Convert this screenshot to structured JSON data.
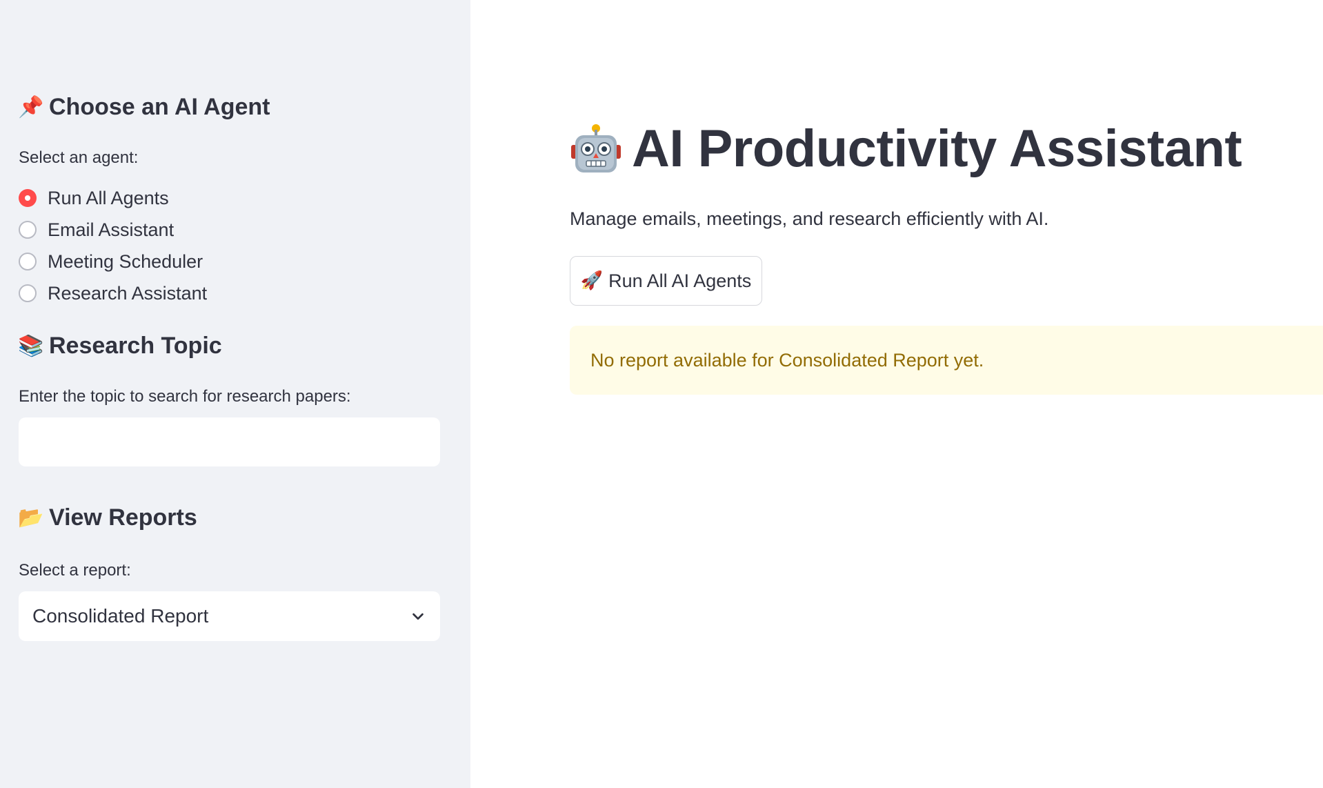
{
  "sidebar": {
    "agent_section": {
      "icon": "pushpin-icon",
      "emoji": "📌",
      "title": "Choose an AI Agent",
      "select_label": "Select an agent:",
      "options": [
        {
          "label": "Run All Agents",
          "selected": true
        },
        {
          "label": "Email Assistant",
          "selected": false
        },
        {
          "label": "Meeting Scheduler",
          "selected": false
        },
        {
          "label": "Research Assistant",
          "selected": false
        }
      ]
    },
    "research_section": {
      "icon": "books-icon",
      "emoji": "📚",
      "title": "Research Topic",
      "input_label": "Enter the topic to search for research papers:",
      "input_value": "",
      "input_placeholder": ""
    },
    "reports_section": {
      "icon": "folder-icon",
      "emoji": "📂",
      "title": "View Reports",
      "select_label": "Select a report:",
      "selected_value": "Consolidated Report"
    }
  },
  "main": {
    "title_icon": "robot-icon",
    "title": "AI Productivity Assistant",
    "subtitle": "Manage emails, meetings, and research efficiently with AI.",
    "run_button": {
      "icon": "rocket-icon",
      "emoji": "🚀",
      "label": "Run All AI Agents"
    },
    "alert": {
      "text": "No report available for Consolidated Report yet."
    }
  },
  "colors": {
    "sidebar_bg": "#f0f2f6",
    "accent": "#ff4b4b",
    "text": "#31333f",
    "warning_bg": "#fffce7",
    "warning_text": "#926c05"
  }
}
